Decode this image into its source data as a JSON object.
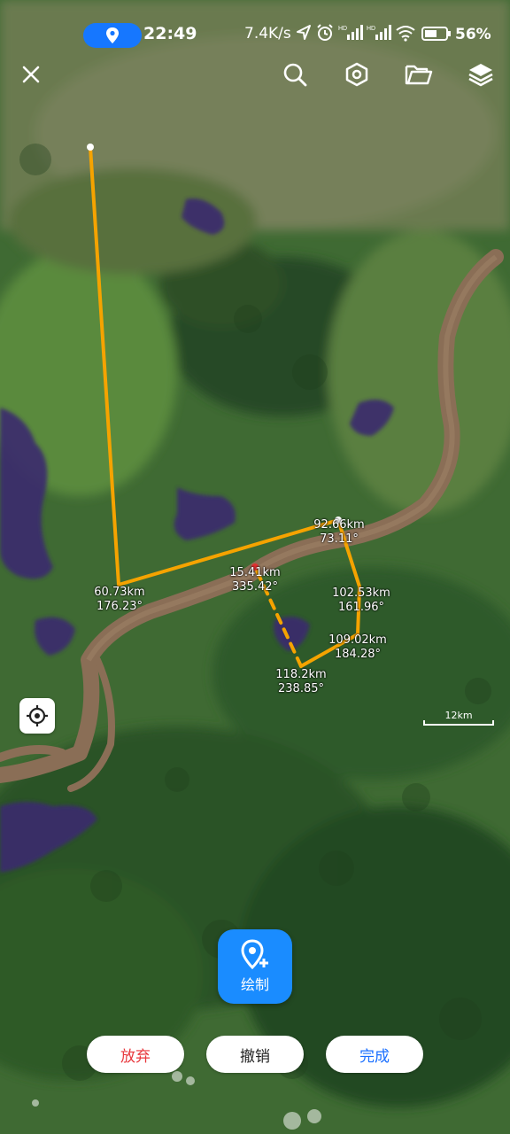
{
  "status_bar": {
    "time": "22:49",
    "net_speed": "7.4K/s",
    "battery": "56%"
  },
  "toolbar": {
    "close_icon": "close-icon",
    "search_icon": "search-icon",
    "settings_icon": "settings-icon",
    "folder_icon": "folder-icon",
    "layers_icon": "layers-icon"
  },
  "measurements": [
    {
      "distance": "60.73km",
      "bearing": "176.23°"
    },
    {
      "distance": "92.66km",
      "bearing": "73.11°"
    },
    {
      "distance": "15.41km",
      "bearing": "335.42°"
    },
    {
      "distance": "102.53km",
      "bearing": "161.96°"
    },
    {
      "distance": "109.02km",
      "bearing": "184.28°"
    },
    {
      "distance": "118.2km",
      "bearing": "238.85°"
    }
  ],
  "scale": "12km",
  "draw_button": {
    "label": "绘制"
  },
  "actions": {
    "discard": "放弃",
    "undo": "撤销",
    "done": "完成"
  },
  "colors": {
    "route": "#f5a300",
    "accent": "#1a8cff",
    "discard": "#e8383d",
    "done": "#1a6fff"
  }
}
